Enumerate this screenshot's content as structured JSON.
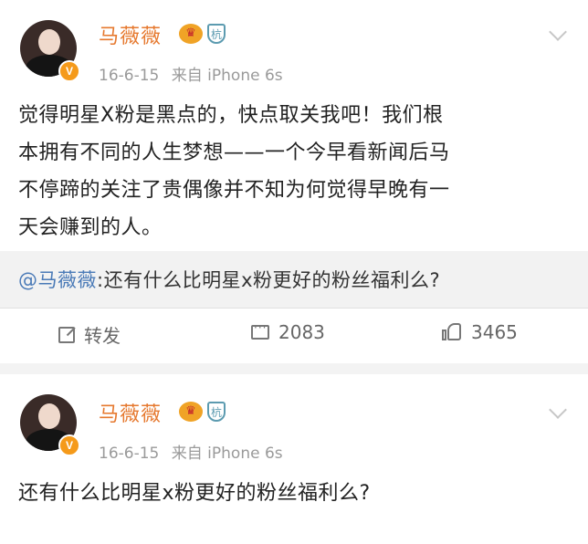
{
  "posts": [
    {
      "username": "马薇薇",
      "time": "16-6-15",
      "source": "来自 iPhone 6s",
      "text_lines": [
        "觉得明星X粉是黑点的，快点取关我吧！我们根",
        "本拥有不同的人生梦想——一个今早看新闻后马",
        "不停蹄的关注了贵偶像并不知为何觉得早晚有一",
        "天会赚到的人。"
      ],
      "repost": {
        "mention": "@马薇薇",
        "text": ":还有什么比明星x粉更好的粉丝福利么?"
      },
      "actions": {
        "share_label": "转发",
        "comment_count": "2083",
        "like_count": "3465"
      }
    },
    {
      "username": "马薇薇",
      "time": "16-6-15",
      "source": "来自 iPhone 6s",
      "text_lines": [
        "还有什么比明星x粉更好的粉丝福利么?"
      ]
    }
  ],
  "colors": {
    "username": "#e6792f",
    "mention": "#4a7ab7",
    "vip_badge": "#f59a1a"
  },
  "icons": {
    "verified": "V",
    "crown": "crown-icon",
    "shield": "shield-icon"
  }
}
